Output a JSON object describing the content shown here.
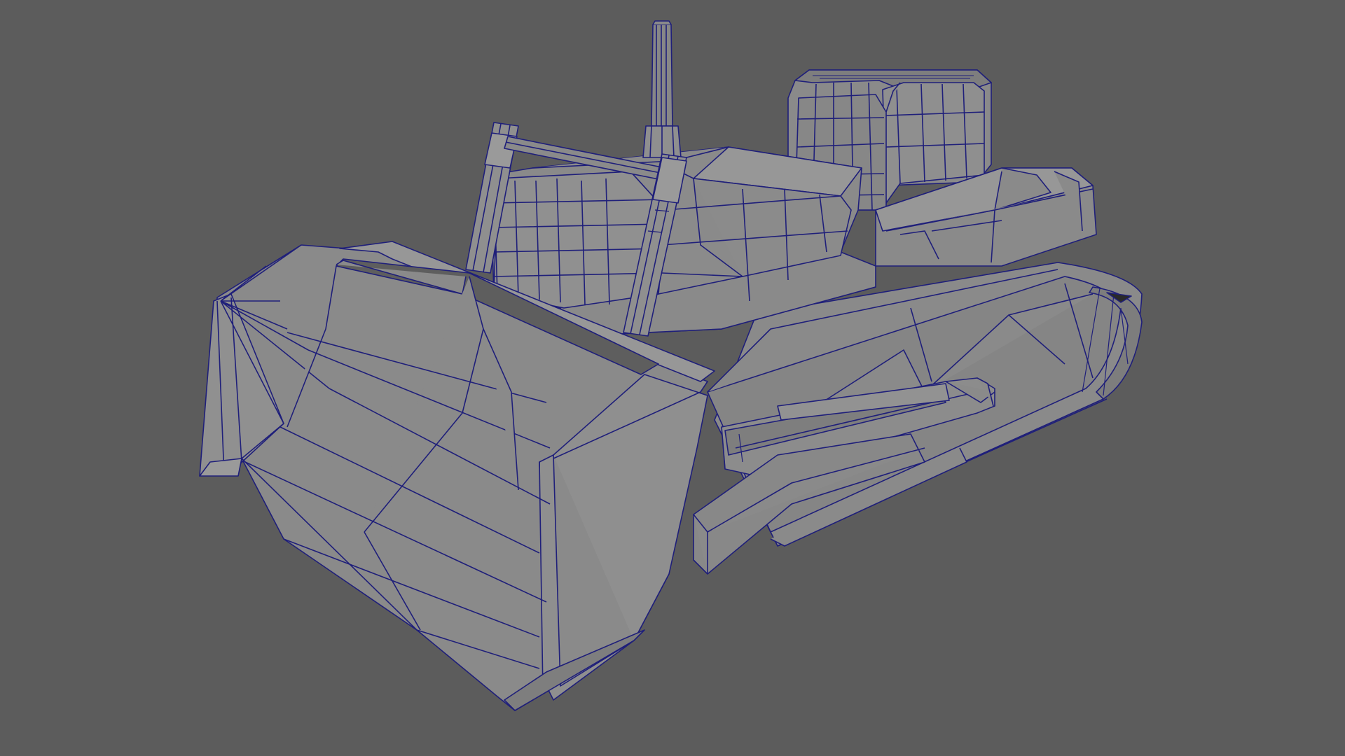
{
  "viewport": {
    "background": "#5c5c5c",
    "shaded_color": "#8a8a8a",
    "dark_face_color": "#5e5e5e",
    "light_face_color": "#969696",
    "wireframe_color": "#1f1f7a"
  },
  "scene": {
    "object": "bulldozer"
  }
}
